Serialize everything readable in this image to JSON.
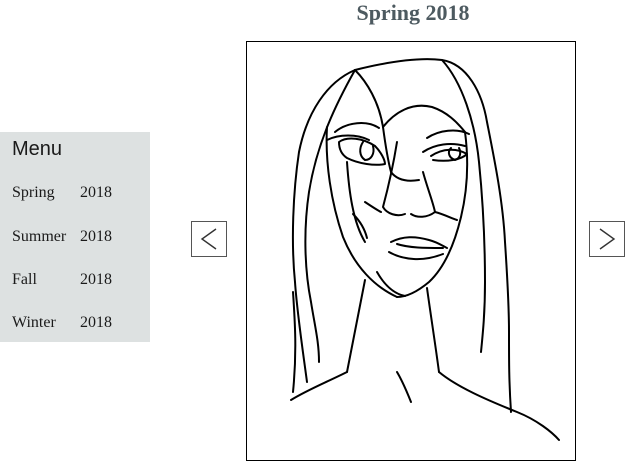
{
  "header": {
    "title": "Spring 2018"
  },
  "menu": {
    "heading": "Menu",
    "items": [
      {
        "season": "Spring",
        "year": "2018"
      },
      {
        "season": "Summer",
        "year": "2018"
      },
      {
        "season": "Fall",
        "year": "2018"
      },
      {
        "season": "Winter",
        "year": "2018"
      }
    ]
  },
  "navigation": {
    "prev_icon": "chevron-left-icon",
    "next_icon": "chevron-right-icon"
  },
  "artwork": {
    "subject": "line-drawing-portrait"
  }
}
